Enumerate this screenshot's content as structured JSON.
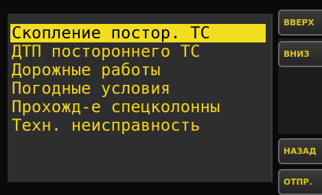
{
  "list": {
    "items": [
      {
        "label": "Скопление постор. ТС",
        "selected": true
      },
      {
        "label": "ДТП постороннего ТС",
        "selected": false
      },
      {
        "label": "Дорожные работы",
        "selected": false
      },
      {
        "label": "Погодные условия",
        "selected": false
      },
      {
        "label": "Прохожд-е спецколонны",
        "selected": false
      },
      {
        "label": "Техн. неисправность",
        "selected": false
      }
    ]
  },
  "buttons": {
    "up_label": "ВВЕРХ",
    "down_label": "ВНИЗ",
    "back_label": "НАЗАД",
    "send_label": "ОТПР."
  },
  "colors": {
    "text": "#f2d21a",
    "highlight": "#f2dd1f",
    "panel": "#2e2e2e"
  }
}
